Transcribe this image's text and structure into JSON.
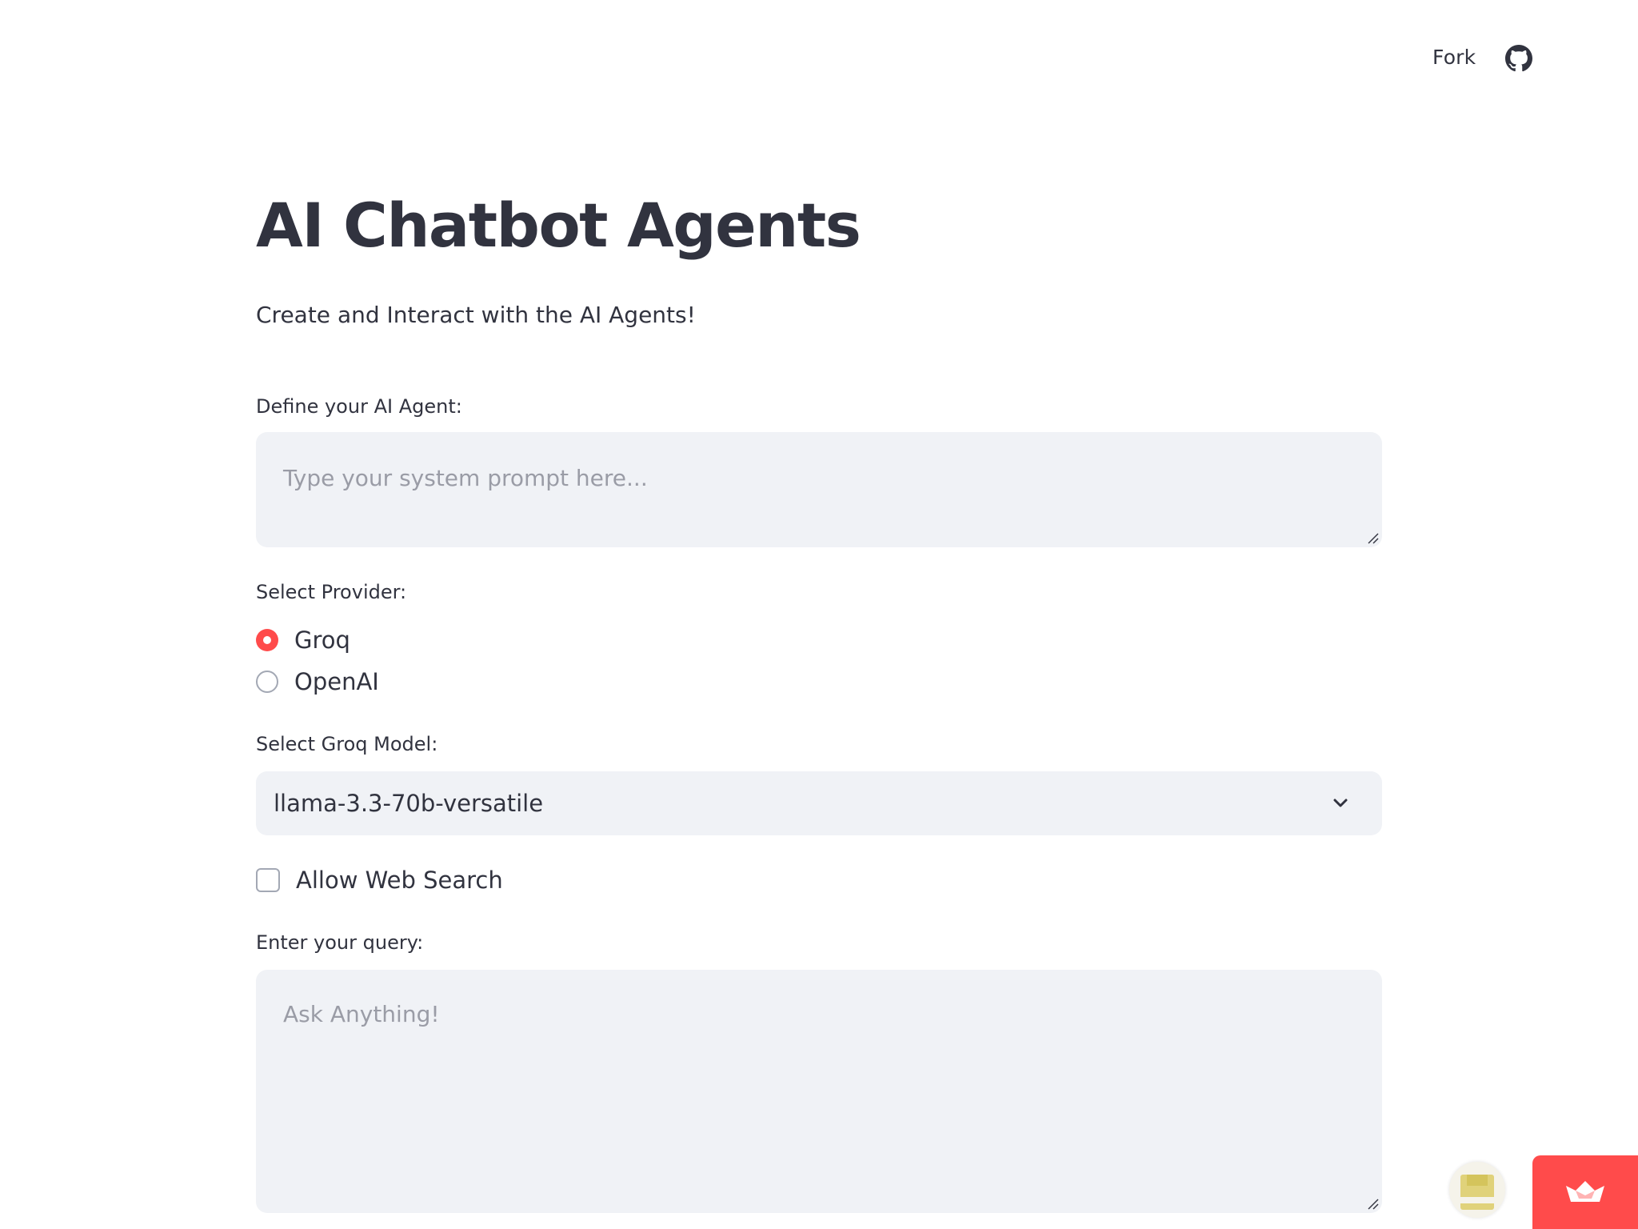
{
  "header": {
    "fork_label": "Fork",
    "github_icon": "github-icon"
  },
  "main": {
    "title": "AI Chatbot Agents",
    "subtitle": "Create and Interact with the AI Agents!",
    "system_prompt": {
      "label": "Define your AI Agent:",
      "placeholder": "Type your system prompt here...",
      "value": ""
    },
    "provider": {
      "label": "Select Provider:",
      "options": [
        {
          "label": "Groq",
          "selected": true
        },
        {
          "label": "OpenAI",
          "selected": false
        }
      ]
    },
    "model": {
      "label": "Select Groq Model:",
      "selected": "llama-3.3-70b-versatile"
    },
    "web_search": {
      "label": "Allow Web Search",
      "checked": false
    },
    "query": {
      "label": "Enter your query:",
      "placeholder": "Ask Anything!",
      "value": ""
    }
  },
  "colors": {
    "accent": "#ff4b4b",
    "text": "#31333f",
    "input_bg": "#f0f2f6",
    "placeholder": "#9a9ca6"
  }
}
